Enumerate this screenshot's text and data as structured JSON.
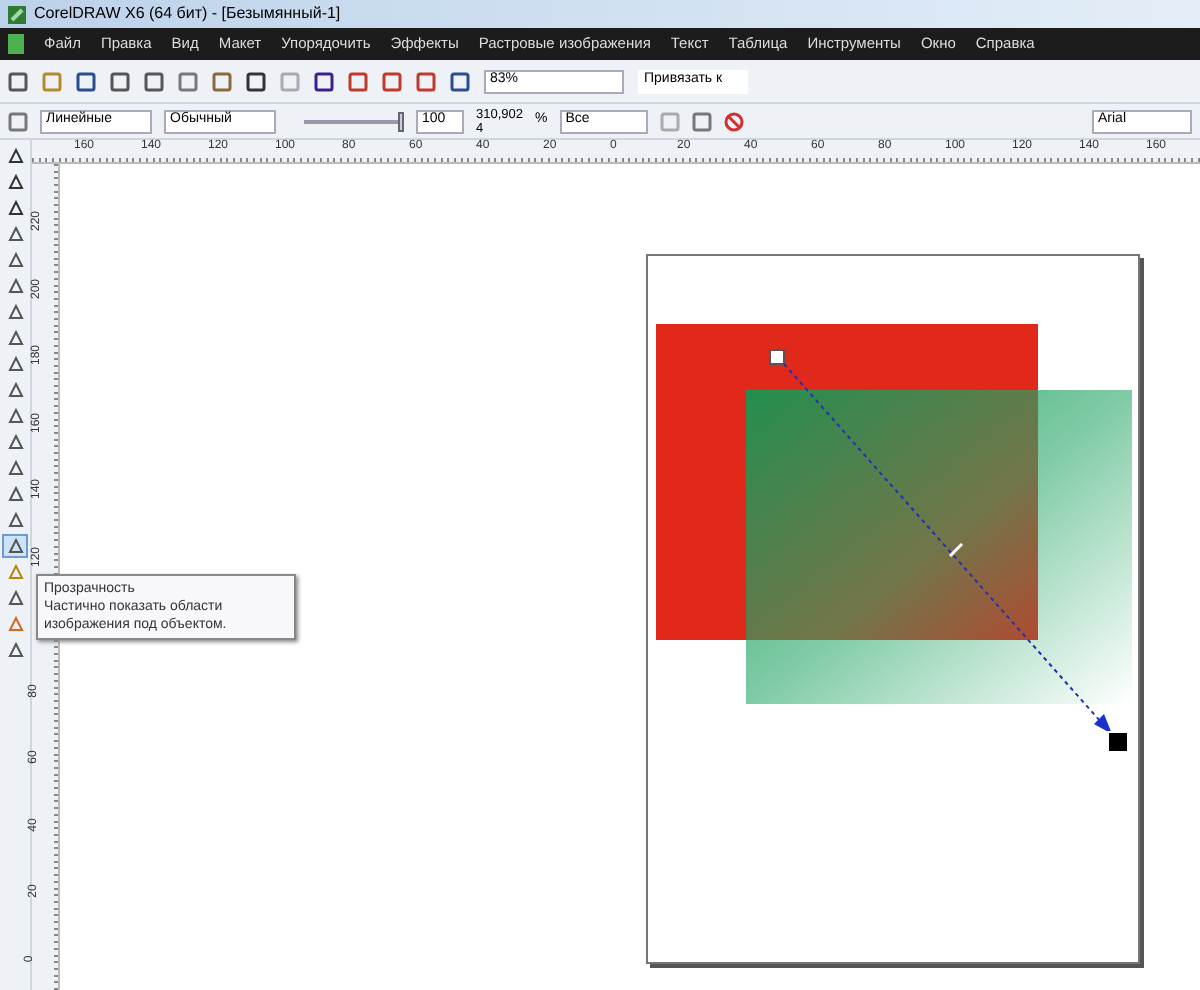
{
  "window": {
    "title": "CorelDRAW X6 (64 бит) - [Безымянный-1]"
  },
  "menu": [
    "Файл",
    "Правка",
    "Вид",
    "Макет",
    "Упорядочить",
    "Эффекты",
    "Растровые изображения",
    "Текст",
    "Таблица",
    "Инструменты",
    "Окно",
    "Справка"
  ],
  "standard_toolbar": {
    "zoom": "83%",
    "snap": "Привязать к"
  },
  "property_bar": {
    "transparency_type": "Линейные",
    "merge_mode": "Обычный",
    "slider": {
      "level": 1
    },
    "slider_value": "100",
    "angle": "310,902",
    "edge": "4",
    "percent": "%",
    "target": "Все",
    "font": "Arial"
  },
  "horizontal_ruler": [
    "160",
    "140",
    "120",
    "100",
    "80",
    "60",
    "40",
    "20",
    "0",
    "20",
    "40",
    "60",
    "80",
    "100",
    "120",
    "140",
    "160"
  ],
  "vertical_ruler": {
    "above_tooltip": [
      "220",
      "200",
      "180",
      "160",
      "140",
      "120"
    ],
    "below_tooltip": [
      "80",
      "60",
      "40",
      "20",
      "0"
    ]
  },
  "toolbox": [
    {
      "selected": false
    },
    {
      "selected": false
    },
    {
      "selected": false
    },
    {
      "selected": false
    },
    {
      "selected": false
    },
    {
      "selected": false
    },
    {
      "selected": false
    },
    {
      "selected": false
    },
    {
      "selected": false
    },
    {
      "selected": false
    },
    {
      "selected": false
    },
    {
      "selected": false
    },
    {
      "selected": false
    },
    {
      "selected": false
    },
    {
      "selected": false
    },
    {
      "selected": true
    },
    {
      "selected": false
    },
    {
      "selected": false
    },
    {
      "selected": false
    },
    {
      "selected": false
    }
  ],
  "tooltip": {
    "title": "Прозрачность",
    "text": "Частично показать области изображения под объектом."
  }
}
